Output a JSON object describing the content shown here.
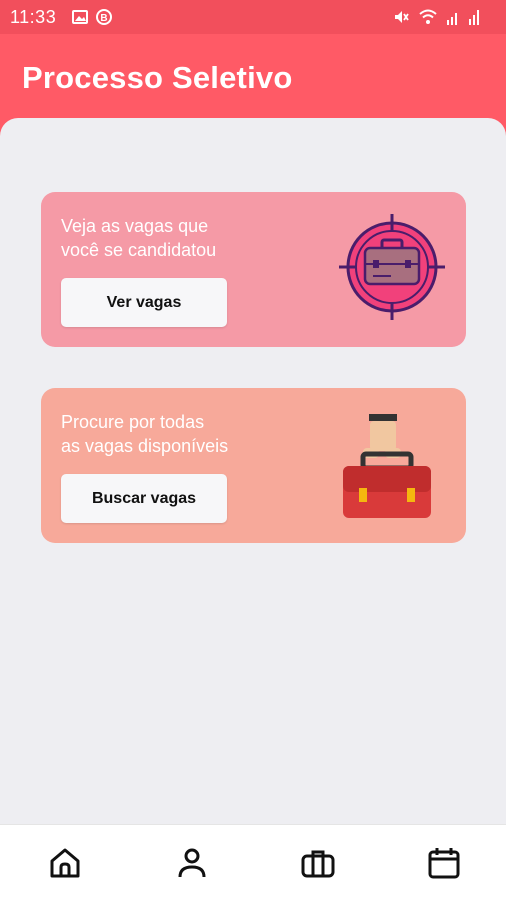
{
  "status_bar": {
    "time": "11:33",
    "left_icons": [
      "image-icon",
      "b-badge-icon"
    ],
    "right_icons": [
      "mute-icon",
      "wifi-icon",
      "signal-icon",
      "signal-2-icon"
    ]
  },
  "header": {
    "title": "Processo Seletivo"
  },
  "cards": [
    {
      "line1": "Veja as vagas que",
      "line2": "você se candidatou",
      "button_label": "Ver vagas",
      "illustration": "target-briefcase-icon"
    },
    {
      "line1": "Procure por todas",
      "line2": "as vagas disponíveis",
      "button_label": "Buscar vagas",
      "illustration": "hand-briefcase-icon"
    }
  ],
  "bottom_nav": {
    "items": [
      {
        "icon": "home-icon"
      },
      {
        "icon": "person-icon"
      },
      {
        "icon": "briefcase-icon"
      },
      {
        "icon": "calendar-icon"
      }
    ]
  },
  "colors": {
    "brand": "#ff5a66",
    "card1": "#f59aa6",
    "card2": "#f7a99a",
    "background": "#eeeef2"
  }
}
